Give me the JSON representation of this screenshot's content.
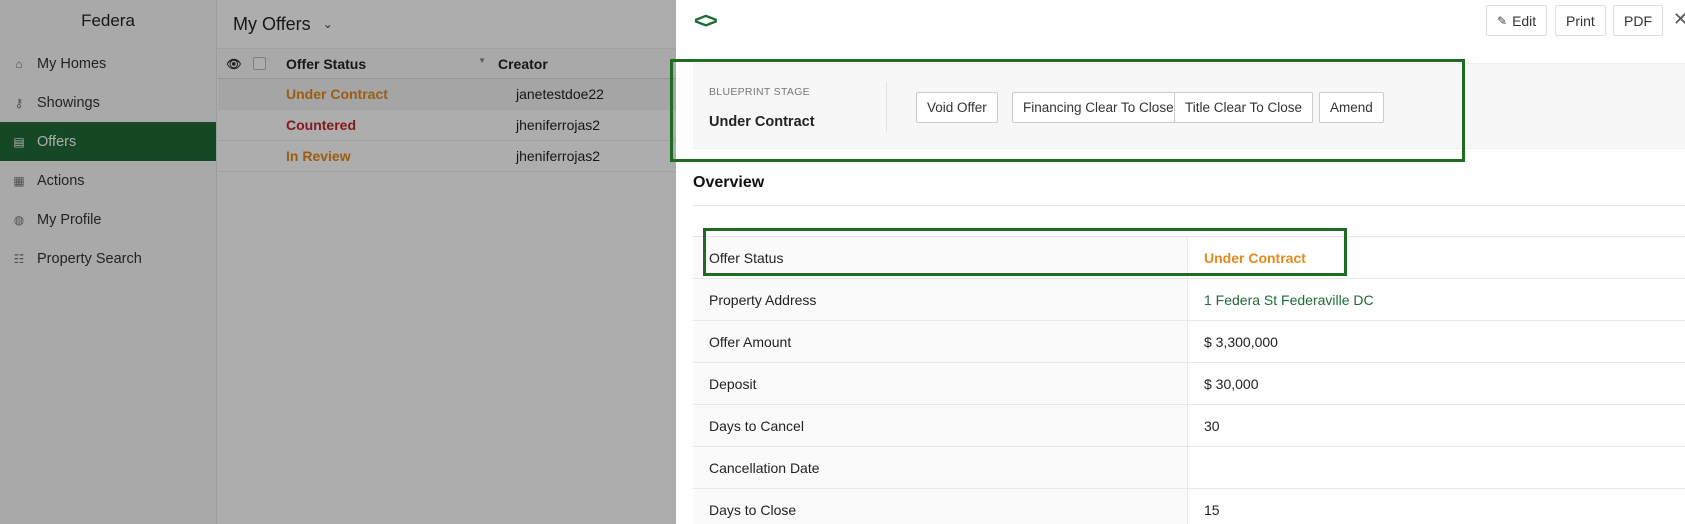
{
  "sidebar": {
    "brand": "Federa",
    "items": [
      {
        "label": "My Homes",
        "icon": "home-icon"
      },
      {
        "label": "Showings",
        "icon": "key-icon"
      },
      {
        "label": "Offers",
        "icon": "document-icon"
      },
      {
        "label": "Actions",
        "icon": "calendar-icon"
      },
      {
        "label": "My Profile",
        "icon": "globe-icon"
      },
      {
        "label": "Property Search",
        "icon": "search-list-icon"
      }
    ]
  },
  "list": {
    "title": "My Offers",
    "columns": {
      "status": "Offer Status",
      "creator": "Creator"
    },
    "rows": [
      {
        "status": "Under Contract",
        "creator": "janetestdoe22",
        "color": "#e68a1c"
      },
      {
        "status": "Countered",
        "creator": "jheniferrojas2",
        "color": "#c0272d"
      },
      {
        "status": "In Review",
        "creator": "jheniferrojas2",
        "color": "#e68a1c"
      }
    ]
  },
  "panel": {
    "toolbar": {
      "edit": "Edit",
      "print": "Print",
      "pdf": "PDF"
    },
    "blueprint": {
      "label": "BLUEPRINT STAGE",
      "value": "Under Contract",
      "actions": [
        "Void Offer",
        "Financing Clear To Close",
        "Title Clear To Close",
        "Amend"
      ]
    },
    "overview_title": "Overview",
    "details": [
      {
        "label": "Offer Status",
        "value": "Under Contract"
      },
      {
        "label": "Property Address",
        "value": "1 Federa St Federaville DC"
      },
      {
        "label": "Offer Amount",
        "value": "$ 3,300,000"
      },
      {
        "label": "Deposit",
        "value": "$ 30,000"
      },
      {
        "label": "Days to Cancel",
        "value": "30"
      },
      {
        "label": "Cancellation Date",
        "value": ""
      },
      {
        "label": "Days to Close",
        "value": "15"
      }
    ]
  },
  "colors": {
    "accent": "#1f6b35",
    "status_orange": "#e68a1c",
    "status_red": "#c0272d",
    "highlight": "#1e6b23"
  }
}
